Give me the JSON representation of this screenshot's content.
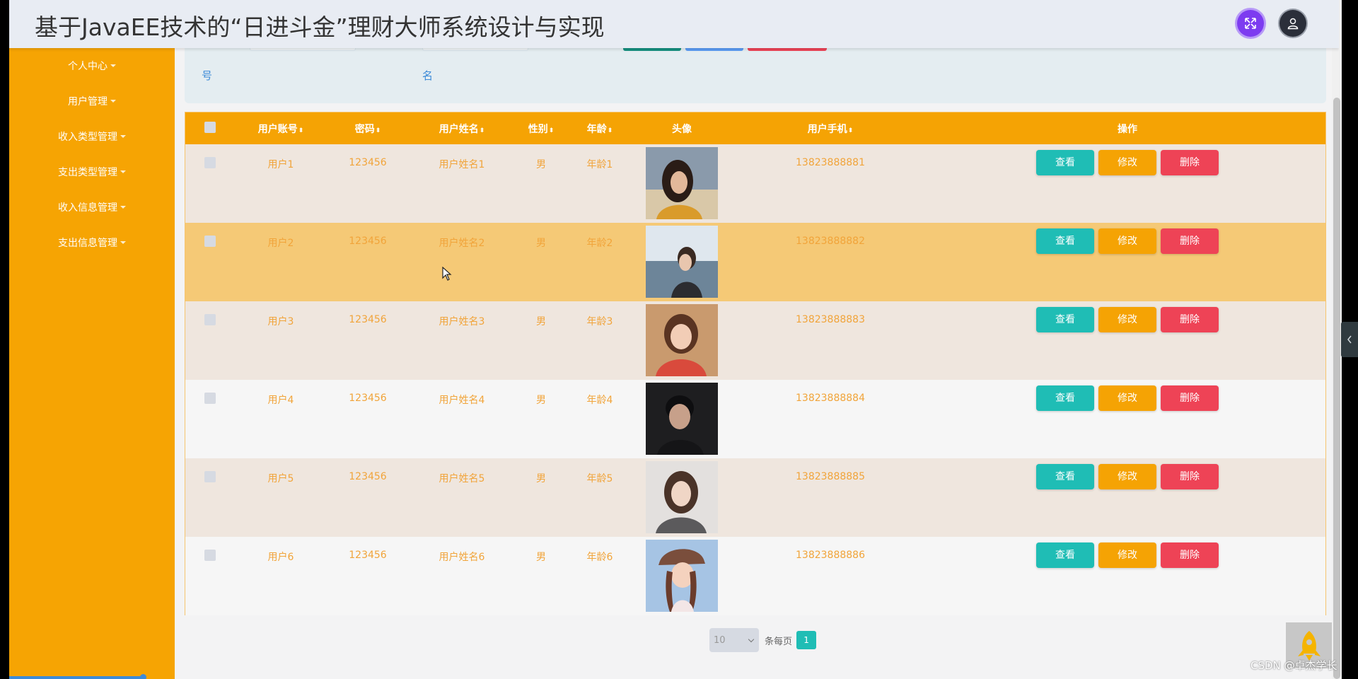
{
  "header": {
    "title": "基于JavaEE技术的“日进斗金”理财大师系统设计与实现"
  },
  "sidebar": {
    "items": [
      {
        "label": "个人中心"
      },
      {
        "label": "用户管理"
      },
      {
        "label": "收入类型管理"
      },
      {
        "label": "支出类型管理"
      },
      {
        "label": "收入信息管理"
      },
      {
        "label": "支出信息管理"
      }
    ]
  },
  "search": {
    "label_1": "号",
    "label_2": "名"
  },
  "table": {
    "columns": [
      "用户账号",
      "密码",
      "用户姓名",
      "性别",
      "年龄",
      "头像",
      "用户手机",
      "操作"
    ],
    "rows": [
      {
        "account": "用户1",
        "password": "123456",
        "name": "用户姓名1",
        "gender": "男",
        "age": "年龄1",
        "phone": "13823888881"
      },
      {
        "account": "用户2",
        "password": "123456",
        "name": "用户姓名2",
        "gender": "男",
        "age": "年龄2",
        "phone": "13823888882"
      },
      {
        "account": "用户3",
        "password": "123456",
        "name": "用户姓名3",
        "gender": "男",
        "age": "年龄3",
        "phone": "13823888883"
      },
      {
        "account": "用户4",
        "password": "123456",
        "name": "用户姓名4",
        "gender": "男",
        "age": "年龄4",
        "phone": "13823888884"
      },
      {
        "account": "用户5",
        "password": "123456",
        "name": "用户姓名5",
        "gender": "男",
        "age": "年龄5",
        "phone": "13823888885"
      },
      {
        "account": "用户6",
        "password": "123456",
        "name": "用户姓名6",
        "gender": "男",
        "age": "年龄6",
        "phone": "13823888886"
      }
    ],
    "actions": {
      "view": "查看",
      "edit": "修改",
      "delete": "删除"
    }
  },
  "pagination": {
    "page_size": "10",
    "per_page_label": "条每页",
    "current_page": "1"
  },
  "watermark": "CSDN @卓杰学长",
  "colors": {
    "sidebar": "#f6a403",
    "header_bg": "#e8ecf3",
    "table_header": "#f5a304",
    "view_button": "#1fbdb5",
    "edit_button": "#f5a304",
    "delete_button": "#ee4356",
    "cell_text": "#f1a43a"
  }
}
